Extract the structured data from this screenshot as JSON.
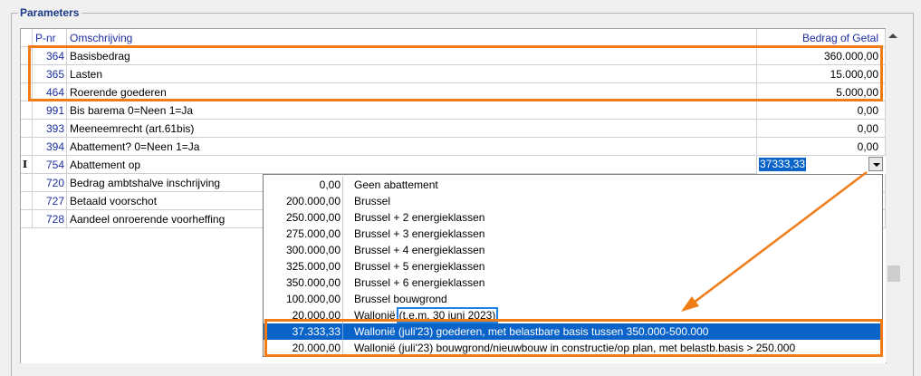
{
  "group_title": "Parameters",
  "columns": {
    "pnr": "P-nr",
    "omschrijving": "Omschrijving",
    "bedrag": "Bedrag of Getal"
  },
  "rows": [
    {
      "pnr": "364",
      "desc": "Basisbedrag",
      "value": "360.000,00"
    },
    {
      "pnr": "365",
      "desc": "Lasten",
      "value": "15.000,00"
    },
    {
      "pnr": "464",
      "desc": "Roerende goederen",
      "value": "5.000,00"
    },
    {
      "pnr": "991",
      "desc": "Bis barema 0=Neen 1=Ja",
      "value": "0,00"
    },
    {
      "pnr": "393",
      "desc": "Meeneemrecht (art.61bis)",
      "value": "0,00"
    },
    {
      "pnr": "394",
      "desc": "Abattement? 0=Neen 1=Ja",
      "value": "0,00"
    },
    {
      "pnr": "754",
      "desc": "Abattement op",
      "value": ""
    },
    {
      "pnr": "720",
      "desc": "Bedrag ambtshalve inschrijving",
      "value": ""
    },
    {
      "pnr": "727",
      "desc": "Betaald voorschot",
      "value": ""
    },
    {
      "pnr": "728",
      "desc": "Aandeel onroerende voorheffing",
      "value": ""
    }
  ],
  "active_row": {
    "cursor": "I",
    "edit_value": "37333,33"
  },
  "dropdown": [
    {
      "amount": "0,00",
      "label": "Geen abattement"
    },
    {
      "amount": "200.000,00",
      "label": "Brussel"
    },
    {
      "amount": "250.000,00",
      "label": "Brussel + 2 energieklassen"
    },
    {
      "amount": "275.000,00",
      "label": "Brussel + 3 energieklassen"
    },
    {
      "amount": "300.000,00",
      "label": "Brussel + 4 energieklassen"
    },
    {
      "amount": "325.000,00",
      "label": "Brussel + 5 energieklassen"
    },
    {
      "amount": "350.000,00",
      "label": "Brussel + 6 energieklassen"
    },
    {
      "amount": "100.000,00",
      "label": "Brussel bouwgrond"
    },
    {
      "amount": "20.000,00",
      "label": "Wallonië",
      "label_focus": "(t.e.m. 30 juni 2023)"
    },
    {
      "amount": "37.333,33",
      "label": "Wallonië (juli'23) goederen, met belastbare basis tussen 350.000-500.000"
    },
    {
      "amount": "20.000,00",
      "label": "Wallonië (juli'23) bouwgrond/nieuwbouw in constructie/op plan, met belastb.basis > 250.000"
    }
  ],
  "colors": {
    "highlight": "#f07c17",
    "selection": "#0a63c9",
    "focus": "#1e82e6",
    "pnr_text": "#1c2ea0"
  }
}
